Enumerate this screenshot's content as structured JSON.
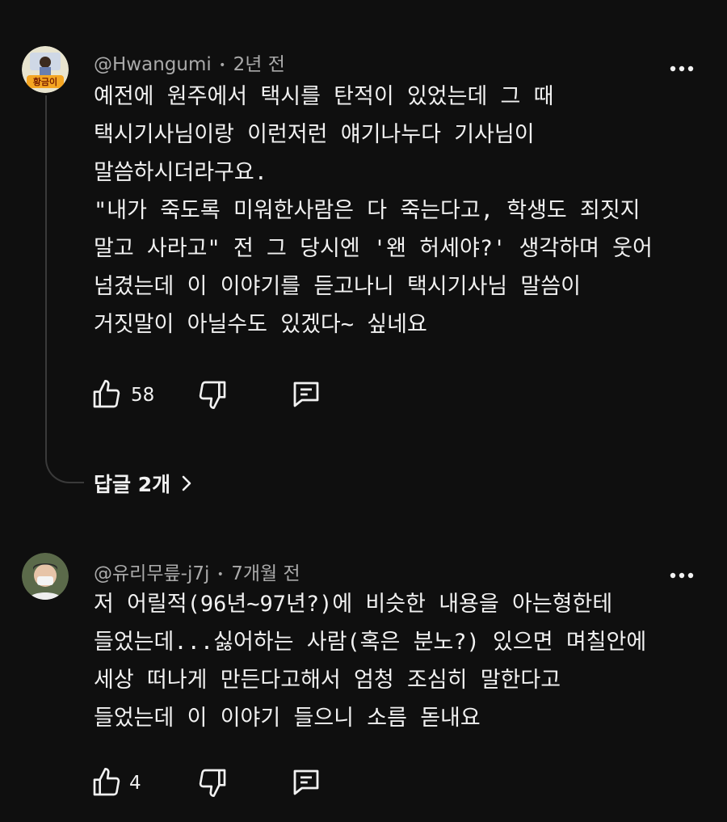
{
  "comments": [
    {
      "author": "@Hwangumi",
      "separator": "•",
      "time": "2년 전",
      "avatar_badge": "황금이",
      "text": "예전에 원주에서 택시를 탄적이 있었는데 그 때\n택시기사님이랑 이런저런 얘기나누다 기사님이\n말씀하시더라구요.\n\"내가 죽도록 미워한사람은 다 죽는다고, 학생도 죄짓지\n말고 사라고\" 전 그 당시엔 '왠 허세야?' 생각하며 웃어\n넘겼는데 이 이야기를 듣고나니 택시기사님 말씀이\n거짓말이 아닐수도 있겠다~ 싶네요",
      "likes": "58",
      "replies_label": "답글 2개",
      "icons": {
        "like": "thumbs-up-icon",
        "dislike": "thumbs-down-icon",
        "reply": "comment-icon",
        "more": "more-vertical-icon",
        "chevron": "chevron-right-icon"
      }
    },
    {
      "author": "@유리무릎-j7j",
      "separator": "•",
      "time": "7개월 전",
      "text": "저 어릴적(96년~97년?)에 비슷한 내용을 아는형한테\n들었는데...싫어하는 사람(혹은 분노?) 있으면 며칠안에\n세상 떠나게 만든다고해서 엄청 조심히 말한다고\n들었는데 이 이야기 들으니 소름 돋내요",
      "likes": "4"
    }
  ],
  "colors": {
    "background": "#0f0f0f",
    "text": "#f1f1f1",
    "meta": "#aaaaaa",
    "thread_line": "#3a3a3a"
  }
}
